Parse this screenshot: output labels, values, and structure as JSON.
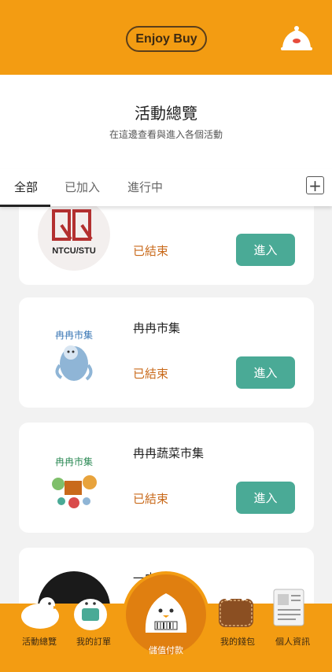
{
  "app": {
    "brand": "Enjoy Buy"
  },
  "header": {
    "title": "活動總覽",
    "subtitle": "在這邊查看與進入各個活動"
  },
  "tabs": [
    {
      "label": "全部",
      "active": true
    },
    {
      "label": "已加入",
      "active": false
    },
    {
      "label": "進行中",
      "active": false
    }
  ],
  "add_tab_symbol": "+",
  "events": [
    {
      "title": "",
      "status": "已結束",
      "button": "進入",
      "logo_text": "NTCU/STU"
    },
    {
      "title": "冉冉市集",
      "status": "已結束",
      "button": "進入",
      "logo_text": "冉冉市集"
    },
    {
      "title": "冉冉蔬菜市集",
      "status": "已結束",
      "button": "進入",
      "logo_text": "冉冉市集"
    },
    {
      "title": "一中...",
      "status": "",
      "button": "",
      "logo_text": ""
    }
  ],
  "bottom_nav": {
    "items": [
      {
        "label": "活動總覽",
        "icon": "mascot-icon"
      },
      {
        "label": "我的訂單",
        "icon": "order-icon"
      },
      {
        "label": "儲值付款",
        "icon": "wallet-mascot-icon"
      },
      {
        "label": "我的錢包",
        "icon": "purse-icon"
      },
      {
        "label": "個人資訊",
        "icon": "profile-icon"
      }
    ]
  },
  "colors": {
    "brand_orange": "#f39c12",
    "enter_green": "#4aaa96",
    "status_orange": "#c96a1b"
  }
}
